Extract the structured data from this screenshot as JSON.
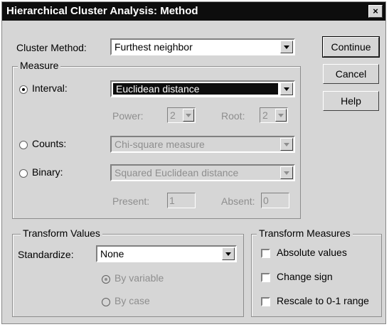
{
  "window": {
    "title": "Hierarchical Cluster Analysis: Method",
    "close_glyph": "×"
  },
  "cluster_method": {
    "label": "Cluster Method:",
    "value": "Furthest neighbor"
  },
  "buttons": {
    "continue": "Continue",
    "cancel": "Cancel",
    "help": "Help"
  },
  "measure": {
    "legend": "Measure",
    "interval": {
      "label": "Interval:",
      "value": "Euclidean distance",
      "selected": true
    },
    "power": {
      "label": "Power:",
      "value": "2"
    },
    "root": {
      "label": "Root:",
      "value": "2"
    },
    "counts": {
      "label": "Counts:",
      "value": "Chi-square measure",
      "selected": false
    },
    "binary": {
      "label": "Binary:",
      "value": "Squared Euclidean distance",
      "selected": false
    },
    "present": {
      "label": "Present:",
      "value": "1"
    },
    "absent": {
      "label": "Absent:",
      "value": "0"
    }
  },
  "transform_values": {
    "legend": "Transform Values",
    "standardize": {
      "label": "Standardize:",
      "value": "None"
    },
    "by_variable": {
      "label": "By variable",
      "selected": true
    },
    "by_case": {
      "label": "By case",
      "selected": false
    }
  },
  "transform_measures": {
    "legend": "Transform Measures",
    "absolute": {
      "label": "Absolute values",
      "checked": false
    },
    "change_sign": {
      "label": "Change sign",
      "checked": false
    },
    "rescale": {
      "label": "Rescale to 0-1 range",
      "checked": false
    }
  },
  "colors": {
    "titlebar": "#0d0d0d",
    "face": "#d6d6d6",
    "disabled_text": "#8e8e8e"
  }
}
